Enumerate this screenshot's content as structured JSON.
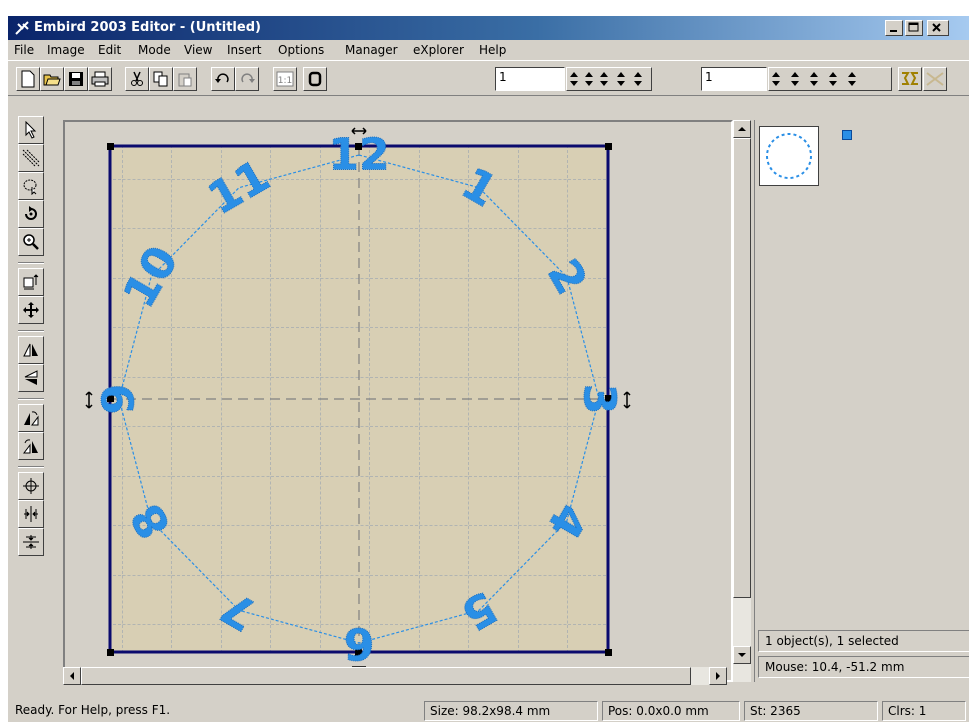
{
  "window": {
    "title": "Embird 2003 Editor - (Untitled)",
    "min_label": "_",
    "max_label": "□",
    "close_label": "×"
  },
  "menu": [
    "File",
    "Image",
    "Edit",
    "Mode",
    "View",
    "Insert",
    "Options",
    "Manager",
    "eXplorer",
    "Help"
  ],
  "toolbar": {
    "spin_value_1": "1",
    "spin_value_2": "1"
  },
  "canvas": {
    "background_color": "#d8cfb4",
    "frame_color": "#0a0a6e",
    "stitch_color": "#2a8fe6",
    "numbers": [
      "12",
      "1",
      "2",
      "3",
      "4",
      "5",
      "6",
      "7",
      "8",
      "9",
      "10",
      "11"
    ]
  },
  "right_panel": {
    "selection_info": "1 object(s), 1 selected",
    "mouse_info": "Mouse: 10.4, -51.2 mm"
  },
  "status": {
    "help": "Ready. For Help, press F1.",
    "size": "Size: 98.2x98.4 mm",
    "pos": "Pos: 0.0x0.0 mm",
    "stitches": "St: 2365",
    "colors": "Clrs: 1"
  }
}
